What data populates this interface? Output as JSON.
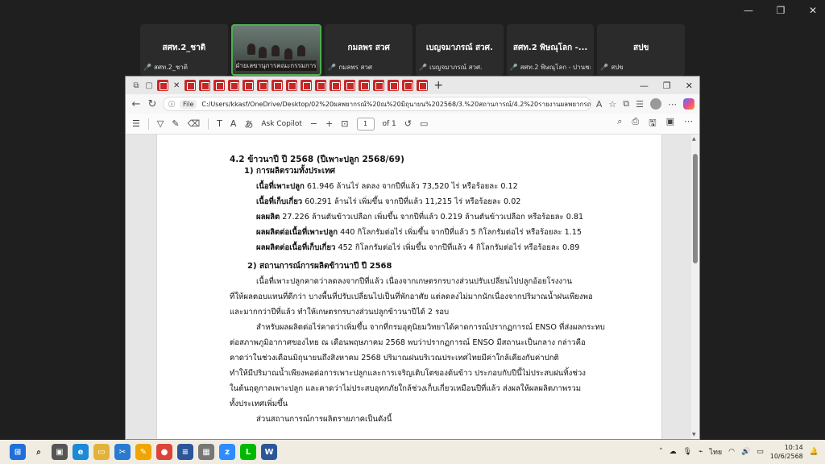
{
  "meeting": {
    "participants": [
      {
        "name": "สศท.2_ชาติ",
        "sub": "สศท.2_ชาติ",
        "muted": true
      },
      {
        "name": "",
        "sub": "ฝ่ายเลขานุการคณะกรรมการฯ",
        "muted": false,
        "video": true
      },
      {
        "name": "กมลพร สวศ",
        "sub": "กมลพร สวศ",
        "muted": true
      },
      {
        "name": "เบญจมาภรณ์ สวศ.",
        "sub": "เบญจมาภรณ์ สวศ.",
        "muted": true
      },
      {
        "name": "สศท.2 พิษณุโลก -...",
        "sub": "สศท.2 พิษณุโลก - ปานชลา",
        "muted": true
      },
      {
        "name": "สปข",
        "sub": "สปข",
        "muted": true
      }
    ]
  },
  "browser": {
    "url_chip": "File",
    "url": "C:/Users/kkasf/OneDrive/Desktop/02%20ผลพยากรณ์%20ณ%20มิถุนายน%202568/3.%20สถานการณ์/4.2%20รายงานผลพยากรณ์ข้อมูลปริ...",
    "pdf_tab_count": 18
  },
  "pdf_toolbar": {
    "ask_copilot": "Ask Copilot",
    "page": "1",
    "of_pages": "of 1",
    "zoom_minus": "−",
    "zoom_plus": "+"
  },
  "doc": {
    "title": "4.2 ข้าวนาปี ปี 2568 (ปีเพาะปลูก 2568/69)",
    "s1_heading": "1) การผลิตรวมทั้งประเทศ",
    "items": [
      {
        "label": "เนื้อที่เพาะปลูก",
        "text": " 61.946 ล้านไร่ ลดลง จากปีที่แล้ว 73,520 ไร่ หรือร้อยละ 0.12"
      },
      {
        "label": "เนื้อที่เก็บเกี่ยว",
        "text": " 60.291 ล้านไร่ เพิ่มขึ้น จากปีที่แล้ว 11,215 ไร่ หรือร้อยละ 0.02"
      },
      {
        "label": "ผลผลิต",
        "text": " 27.226 ล้านตันข้าวเปลือก เพิ่มขึ้น จากปีที่แล้ว 0.219 ล้านตันข้าวเปลือก หรือร้อยละ 0.81"
      },
      {
        "label": "ผลผลิตต่อเนื้อที่เพาะปลูก",
        "text": " 440 กิโลกรัมต่อไร่ เพิ่มขึ้น จากปีที่แล้ว 5 กิโลกรัมต่อไร่ หรือร้อยละ 1.15"
      },
      {
        "label": "ผลผลิตต่อเนื้อที่เก็บเกี่ยว",
        "text": " 452 กิโลกรัมต่อไร่ เพิ่มขึ้น จากปีที่แล้ว 4 กิโลกรัมต่อไร่ หรือร้อยละ 0.89"
      }
    ],
    "s2_heading": "2) สถานการณ์การผลิตข้าวนาปี ปี 2568",
    "para1": [
      "เนื้อที่เพาะปลูกคาดว่าลดลงจากปีที่แล้ว เนื่องจากเกษตรกรบางส่วนปรับเปลี่ยนไปปลูกอ้อยโรงงาน",
      "ที่ให้ผลตอบแทนที่ดีกว่า บางพื้นที่ปรับเปลี่ยนไปเป็นที่พักอาศัย แต่ลดลงไม่มากนักเนื่องจากปริมาณน้ำฝนเพียงพอ",
      "และมากกว่าปีที่แล้ว ทำให้เกษตรกรบางส่วนปลูกข้าวนาปีได้ 2 รอบ"
    ],
    "para2": [
      "สำหรับผลผลิตต่อไร่คาดว่าเพิ่มขึ้น จากที่กรมอุตุนิยมวิทยาได้คาดการณ์ปรากฏการณ์ ENSO ที่ส่งผลกระทบ",
      "ต่อสภาพภูมิอากาศของไทย ณ เดือนพฤษภาคม 2568 พบว่าปรากฏการณ์ ENSO มีสถานะเป็นกลาง กล่าวคือ",
      "คาดว่าในช่วงเดือนมิถุนายนถึงสิงหาคม 2568 ปริมาณฝนบริเวณประเทศไทยมีค่าใกล้เคียงกับค่าปกติ",
      "ทำให้มีปริมาณน้ำเพียงพอต่อการเพาะปลูกและการเจริญเติบโตของต้นข้าว ประกอบกับปีนี้ไม่ประสบฝนทิ้งช่วง",
      "ในต้นฤดูกาลเพาะปลูก และคาดว่าไม่ประสบอุทกภัยใกล้ช่วงเก็บเกี่ยวเหมือนปีที่แล้ว ส่งผลให้ผลผลิตภาพรวม",
      "ทั้งประเทศเพิ่มขึ้น"
    ],
    "para3": "ส่วนสถานการณ์การผลิตรายภาคเป็นดังนี้"
  },
  "taskbar": {
    "lang": "ไทย",
    "time": "10:14",
    "date": "10/6/2568"
  },
  "colors": {
    "pdf_red": "#c62828",
    "active_tile": "#4caf50"
  }
}
